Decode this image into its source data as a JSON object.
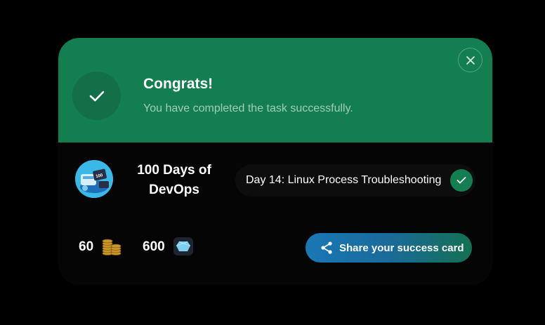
{
  "header": {
    "title": "Congrats!",
    "subtitle": "You have completed the task successfully.",
    "close_icon": "close-icon",
    "status_icon": "check-icon",
    "background_color": "#137e50"
  },
  "course": {
    "name": "100 Days of DevOps",
    "logo_icon": "course-logo",
    "logo_text": "100"
  },
  "task": {
    "label": "Day 14: Linux Process Troubleshooting",
    "status_icon": "check-icon"
  },
  "rewards": {
    "coins": "60",
    "coins_icon": "coins-icon",
    "gems": "600",
    "gems_icon": "gem-icon"
  },
  "share_button": {
    "label": "Share your success card",
    "icon": "share-icon"
  },
  "colors": {
    "accent": "#137e50",
    "share_gradient_start": "#1978b5",
    "share_gradient_end": "#147052"
  }
}
